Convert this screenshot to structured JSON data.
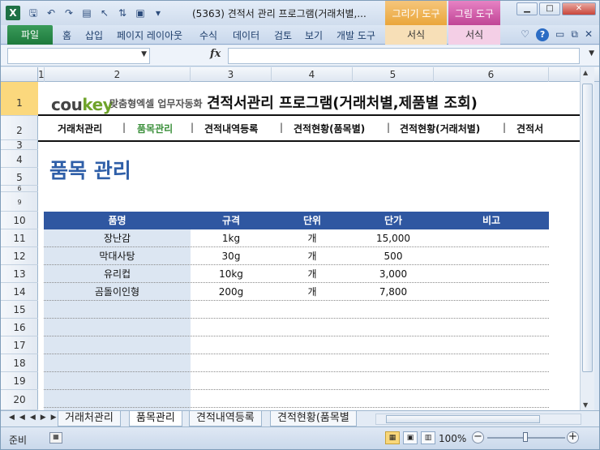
{
  "window": {
    "app_icon": "X",
    "title": "(5363) 견적서 관리 프로그램(거래처별,...",
    "context_tabs": [
      "그리기 도구",
      "그림 도구"
    ]
  },
  "ribbon": {
    "file": "파일",
    "tabs": [
      "홈",
      "삽입",
      "페이지 레이아웃",
      "수식",
      "데이터",
      "검토",
      "보기",
      "개발 도구"
    ],
    "context_subtabs": [
      "서식",
      "서식"
    ]
  },
  "formula_bar": {
    "fx": "fx"
  },
  "columns": [
    "1",
    "2",
    "3",
    "4",
    "5",
    "6"
  ],
  "rows": [
    "1",
    "2",
    "3",
    "4",
    "5",
    "6",
    "9",
    "10",
    "11",
    "12",
    "13",
    "14",
    "15",
    "16",
    "17",
    "18",
    "19",
    "20"
  ],
  "sheet": {
    "logo_co": "cou",
    "logo_key": "key",
    "logo_tag": "맞춤형엑셀 업무자동화",
    "app_title": "견적서관리 프로그램(거래처별,제품별 조회)",
    "nav": [
      "거래처관리",
      "품목관리",
      "견적내역등록",
      "견적현황(품목별)",
      "견적현황(거래처별)",
      "견적서"
    ],
    "nav_sep": "|",
    "page_title": "품목 관리",
    "table_headers": [
      "품명",
      "규격",
      "단위",
      "단가",
      "비고"
    ],
    "table_rows": [
      [
        "장난감",
        "1kg",
        "개",
        "15,000",
        ""
      ],
      [
        "막대사탕",
        "30g",
        "개",
        "500",
        ""
      ],
      [
        "유리컵",
        "10kg",
        "개",
        "3,000",
        ""
      ],
      [
        "곰돌이인형",
        "200g",
        "개",
        "7,800",
        ""
      ]
    ]
  },
  "sheet_tabs": [
    "거래처관리",
    "품목관리",
    "견적내역등록",
    "견적현황(품목별"
  ],
  "status": {
    "ready": "준비",
    "zoom": "100%"
  }
}
